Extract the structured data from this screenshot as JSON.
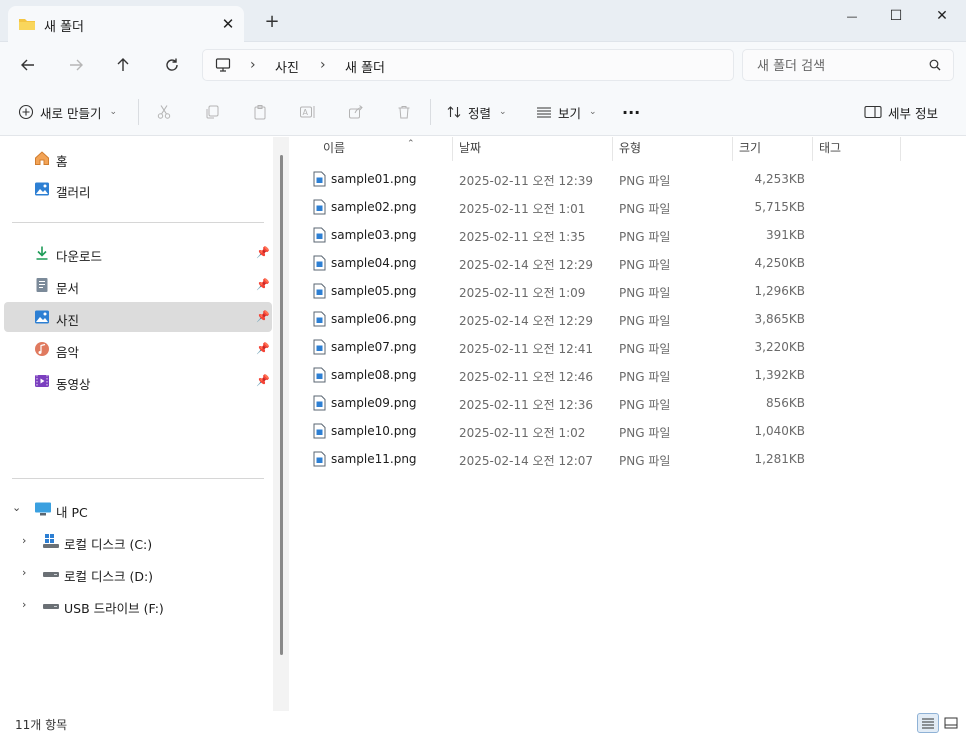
{
  "window": {
    "tab_title": "새 폴더",
    "tab_close": "✕",
    "new_tab": "+",
    "minimize": "—",
    "maximize": "☐",
    "close": "✕"
  },
  "nav": {
    "breadcrumbs": [
      "사진",
      "새 폴더"
    ],
    "separator": "›",
    "search_placeholder": "새 폴더 검색"
  },
  "toolbar": {
    "new_label": "새로 만들기",
    "sort_label": "정렬",
    "view_label": "보기",
    "more_label": "···",
    "details_label": "세부 정보",
    "chevron": "⌄"
  },
  "sidebar": {
    "quick": [
      {
        "label": "홈",
        "icon": "home-icon"
      },
      {
        "label": "갤러리",
        "icon": "gallery-icon"
      }
    ],
    "pinned": [
      {
        "label": "다운로드",
        "icon": "download-icon"
      },
      {
        "label": "문서",
        "icon": "document-icon"
      },
      {
        "label": "사진",
        "icon": "pictures-icon",
        "selected": true
      },
      {
        "label": "음악",
        "icon": "music-icon"
      },
      {
        "label": "동영상",
        "icon": "video-icon"
      }
    ],
    "pc": {
      "label": "내 PC",
      "drives": [
        {
          "label": "로컬 디스크 (C:)"
        },
        {
          "label": "로컬 디스크 (D:)"
        },
        {
          "label": "USB 드라이브 (F:)"
        }
      ]
    }
  },
  "columns": [
    "이름",
    "날짜",
    "유형",
    "크기",
    "태그"
  ],
  "files": [
    {
      "name": "sample01.png",
      "date": "2025-02-11 오전 12:39",
      "type": "PNG 파일",
      "size": "4,253KB"
    },
    {
      "name": "sample02.png",
      "date": "2025-02-11 오전 1:01",
      "type": "PNG 파일",
      "size": "5,715KB"
    },
    {
      "name": "sample03.png",
      "date": "2025-02-11 오전 1:35",
      "type": "PNG 파일",
      "size": "391KB"
    },
    {
      "name": "sample04.png",
      "date": "2025-02-14 오전 12:29",
      "type": "PNG 파일",
      "size": "4,250KB"
    },
    {
      "name": "sample05.png",
      "date": "2025-02-11 오전 1:09",
      "type": "PNG 파일",
      "size": "1,296KB"
    },
    {
      "name": "sample06.png",
      "date": "2025-02-14 오전 12:29",
      "type": "PNG 파일",
      "size": "3,865KB"
    },
    {
      "name": "sample07.png",
      "date": "2025-02-11 오전 12:41",
      "type": "PNG 파일",
      "size": "3,220KB"
    },
    {
      "name": "sample08.png",
      "date": "2025-02-11 오전 12:46",
      "type": "PNG 파일",
      "size": "1,392KB"
    },
    {
      "name": "sample09.png",
      "date": "2025-02-11 오전 12:36",
      "type": "PNG 파일",
      "size": "856KB"
    },
    {
      "name": "sample10.png",
      "date": "2025-02-11 오전 1:02",
      "type": "PNG 파일",
      "size": "1,040KB"
    },
    {
      "name": "sample11.png",
      "date": "2025-02-14 오전 12:07",
      "type": "PNG 파일",
      "size": "1,281KB"
    }
  ],
  "status": {
    "item_count": "11개 항목"
  },
  "colors": {
    "accent": "#0067c0",
    "folder": "#f4c542",
    "selection": "#dcdcdc"
  }
}
